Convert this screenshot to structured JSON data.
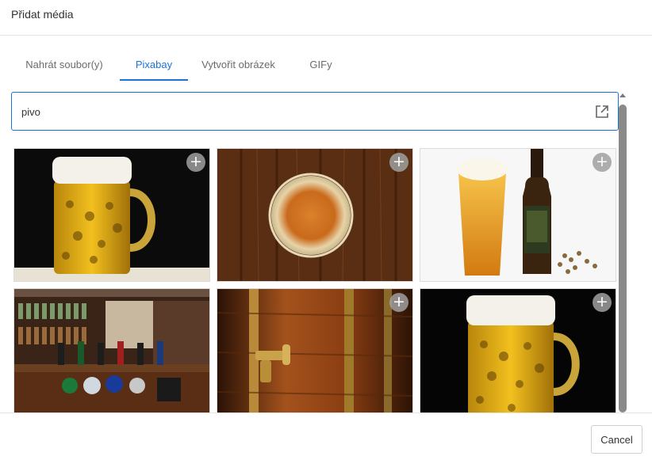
{
  "dialog": {
    "title": "Přidat média"
  },
  "tabs": [
    {
      "label": "Nahrát soubor(y)",
      "active": false
    },
    {
      "label": "Pixabay",
      "active": true
    },
    {
      "label": "Vytvořit obrázek",
      "active": false
    },
    {
      "label": "GIFy",
      "active": false
    }
  ],
  "search": {
    "value": "pivo",
    "open_icon": "external-link-icon"
  },
  "gallery": {
    "add_icon": "plus-icon",
    "add_symbol": "+",
    "items": [
      {
        "subject": "beer-mug-dark-background"
      },
      {
        "subject": "beer-glass-top-view-on-wood"
      },
      {
        "subject": "beer-glass-and-bottle"
      },
      {
        "subject": "bar-counter-with-taps"
      },
      {
        "subject": "wooden-barrel-with-tap"
      },
      {
        "subject": "beer-mug-dark-background"
      }
    ]
  },
  "footer": {
    "cancel_label": "Cancel"
  },
  "colors": {
    "accent": "#1a73d8",
    "border": "#e4e4e4"
  }
}
